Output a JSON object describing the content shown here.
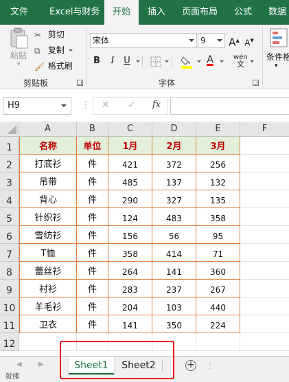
{
  "ribbon_tabs": [
    "文件",
    "Excel与财务",
    "开始",
    "插入",
    "页面布局",
    "公式",
    "数据"
  ],
  "active_tab": "开始",
  "clipboard": {
    "paste": "粘贴",
    "cut": "剪切",
    "copy": "复制",
    "format_painter": "格式刷",
    "group_label": "剪贴板"
  },
  "font": {
    "font_name": "宋体",
    "font_size": "9",
    "bold": "B",
    "italic": "I",
    "underline": "U",
    "grow": "A",
    "shrink": "A",
    "font_color_letter": "A",
    "phonetic": "wén",
    "group_label": "字体"
  },
  "styles": {
    "conditional": "条件格"
  },
  "formula_bar": {
    "name_box": "H9",
    "fx_label": "fx",
    "cancel": "✕",
    "enter": "✓",
    "value": ""
  },
  "columns": [
    "A",
    "B",
    "C",
    "D",
    "E",
    "F"
  ],
  "rows": [
    "1",
    "2",
    "3",
    "4",
    "5",
    "6",
    "7",
    "8",
    "9",
    "10",
    "11",
    "12"
  ],
  "table": {
    "headers": [
      "名称",
      "单位",
      "1月",
      "2月",
      "3月"
    ],
    "rows": [
      [
        "打底衫",
        "件",
        "421",
        "372",
        "256"
      ],
      [
        "吊带",
        "件",
        "485",
        "137",
        "132"
      ],
      [
        "背心",
        "件",
        "290",
        "327",
        "135"
      ],
      [
        "针织衫",
        "件",
        "124",
        "483",
        "358"
      ],
      [
        "雪纺衫",
        "件",
        "156",
        "56",
        "95"
      ],
      [
        "T恤",
        "件",
        "358",
        "414",
        "71"
      ],
      [
        "蕾丝衫",
        "件",
        "264",
        "141",
        "360"
      ],
      [
        "衬衫",
        "件",
        "283",
        "237",
        "267"
      ],
      [
        "羊毛衫",
        "件",
        "204",
        "103",
        "440"
      ],
      [
        "卫衣",
        "件",
        "141",
        "350",
        "224"
      ]
    ]
  },
  "sheets": [
    "Sheet1",
    "Sheet2"
  ],
  "active_sheet": "Sheet1",
  "status_text": "就绪",
  "colors": {
    "ribbon": "#217346",
    "header_fill": "#e2efda",
    "header_text": "#c00000",
    "table_border": "#e07b39",
    "highlight_box": "#e11111"
  }
}
